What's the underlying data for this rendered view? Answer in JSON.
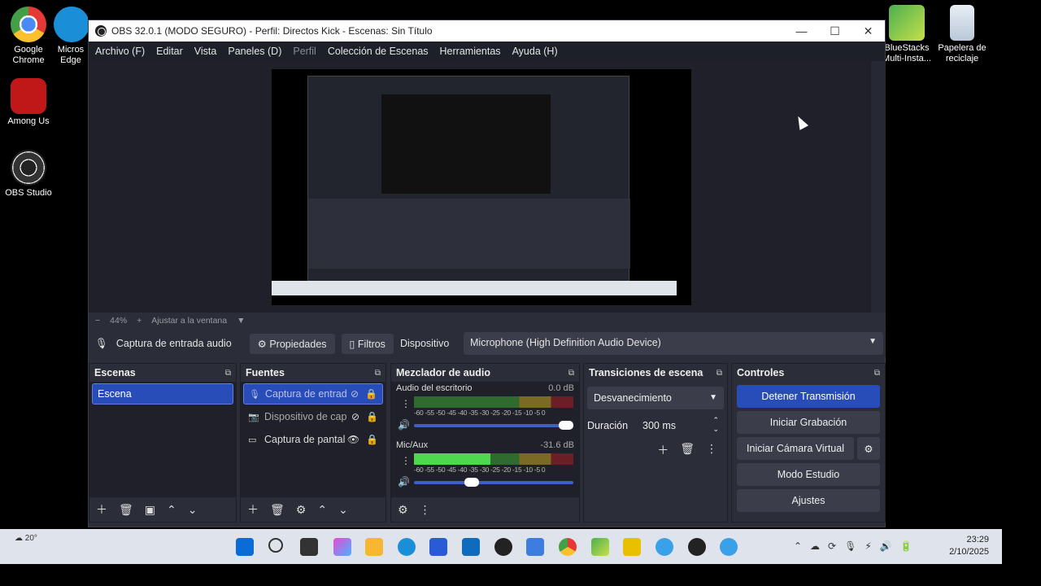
{
  "desktop": {
    "icons_left": [
      {
        "label": "Google Chrome",
        "icon": "chrome-icon"
      },
      {
        "label": "Among Us",
        "icon": "among-us-icon"
      },
      {
        "label": "OBS Studio",
        "icon": "obs-icon"
      }
    ],
    "icon_partial": {
      "label": "Micros Edge",
      "icon": "edge-icon"
    },
    "icons_right": [
      {
        "label": "BlueStacks Multi-Insta...",
        "icon": "bluestacks-icon"
      },
      {
        "label": "Papelera de reciclaje",
        "icon": "recycle-bin-icon"
      }
    ]
  },
  "window": {
    "title": "OBS 32.0.1 (MODO SEGURO) - Perfil: Directos Kick - Escenas: Sin Título",
    "controls": {
      "minimize": "—",
      "maximize": "☐",
      "close": "✕"
    }
  },
  "menu": {
    "items": [
      "Archivo (F)",
      "Editar",
      "Vista",
      "Paneles (D)",
      "Perfil",
      "Colección de Escenas",
      "Herramientas",
      "Ayuda (H)"
    ],
    "disabled_index": 4
  },
  "zoom": {
    "minus": "−",
    "value": "44%",
    "plus": "+",
    "fit_label": "Ajustar a la ventana",
    "dropdown": "▼"
  },
  "source_toolbar": {
    "source_name": "Captura de entrada audio",
    "properties_label": "Propiedades",
    "filters_label": "Filtros",
    "device_label": "Dispositivo",
    "device_value": "Microphone (High Definition Audio Device)"
  },
  "scenes": {
    "title": "Escenas",
    "items": [
      "Escena"
    ]
  },
  "sources": {
    "title": "Fuentes",
    "items": [
      {
        "label": "Captura de entrad",
        "icon": "microphone-icon"
      },
      {
        "label": "Dispositivo de cap",
        "icon": "camera-icon"
      },
      {
        "label": "Captura de pantal",
        "icon": "monitor-icon"
      }
    ]
  },
  "mixer": {
    "title": "Mezclador de audio",
    "channels": [
      {
        "name": "Audio del escritorio",
        "db": "0.0 dB",
        "level": 0.0,
        "volume": 1.0
      },
      {
        "name": "Mic/Aux",
        "db": "-31.6 dB",
        "level": 0.48,
        "volume": 0.35
      }
    ],
    "ticks": "-60 -55 -50 -45 -40 -35 -30 -25 -20 -15 -10 -5 0"
  },
  "transitions": {
    "title": "Transiciones de escena",
    "selected": "Desvanecimiento",
    "duration_label": "Duración",
    "duration_value": "300 ms"
  },
  "controls": {
    "title": "Controles",
    "stop_stream": "Detener Transmisión",
    "start_recording": "Iniciar Grabación",
    "virtual_camera": "Iniciar Cámara Virtual",
    "studio_mode": "Modo Estudio",
    "settings": "Ajustes"
  },
  "taskbar": {
    "weather": "20°",
    "time": "23:29",
    "date": "2/10/2025"
  },
  "colors": {
    "accent": "#284cb8",
    "panel": "#2b2e38",
    "panel_dark": "#1f2029"
  }
}
